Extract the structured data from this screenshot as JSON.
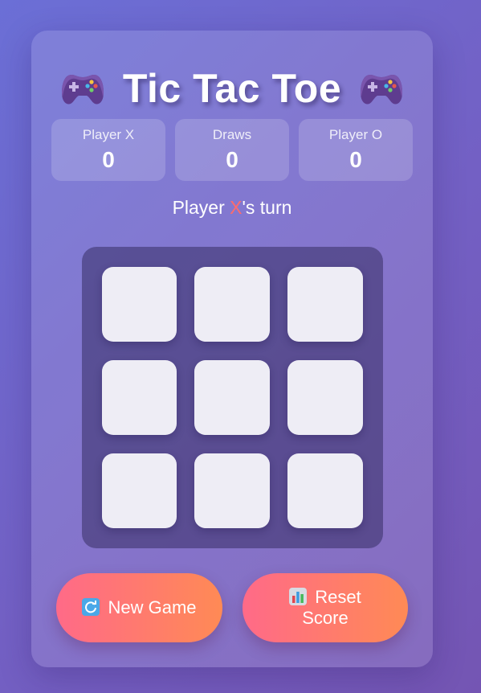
{
  "header": {
    "title": "Tic Tac Toe",
    "left_icon": "gamepad-icon",
    "right_icon": "gamepad-icon"
  },
  "scoreboard": [
    {
      "label": "Player X",
      "value": "0"
    },
    {
      "label": "Draws",
      "value": "0"
    },
    {
      "label": "Player O",
      "value": "0"
    }
  ],
  "status": {
    "prefix": "Player ",
    "current_player": "X",
    "suffix": "'s turn"
  },
  "board": {
    "cells": [
      "",
      "",
      "",
      "",
      "",
      "",
      "",
      "",
      ""
    ]
  },
  "buttons": {
    "new_game": {
      "icon": "refresh-icon",
      "label": "New Game"
    },
    "reset_score": {
      "icon": "bar-chart-icon",
      "label": "Reset Score"
    }
  },
  "colors": {
    "x_mark": "#ff6b6b",
    "button_gradient_start": "#ff6a88",
    "button_gradient_end": "#ff8a55",
    "cell": "#eeedf5"
  }
}
